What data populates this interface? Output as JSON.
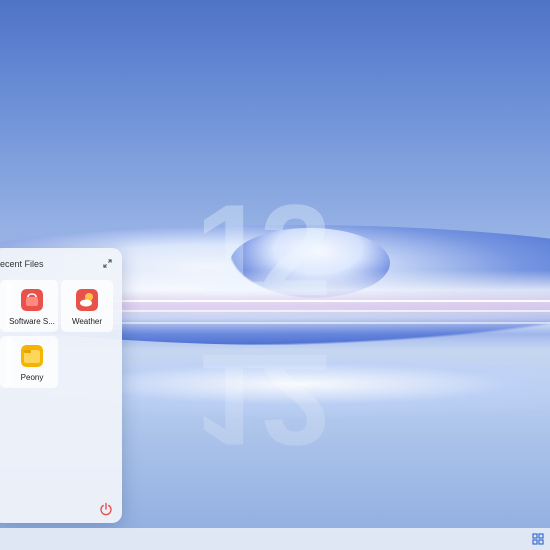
{
  "start_menu": {
    "title": "ecent Files",
    "apps": [
      {
        "label": "Software S...",
        "icon": "shopping-bag-icon",
        "color": "#e8524a"
      },
      {
        "label": "Weather",
        "icon": "weather-icon",
        "color": "#e8524a"
      },
      {
        "label": "Peony",
        "icon": "folder-icon",
        "color": "#f5b400"
      }
    ],
    "expand_icon": "expand-icon",
    "power_icon": "power-icon",
    "power_color": "#e8524a"
  },
  "wallpaper": {
    "number": "12"
  },
  "taskbar": {
    "tray_icon": "grid-icon",
    "tray_color": "#3a6fd0"
  }
}
